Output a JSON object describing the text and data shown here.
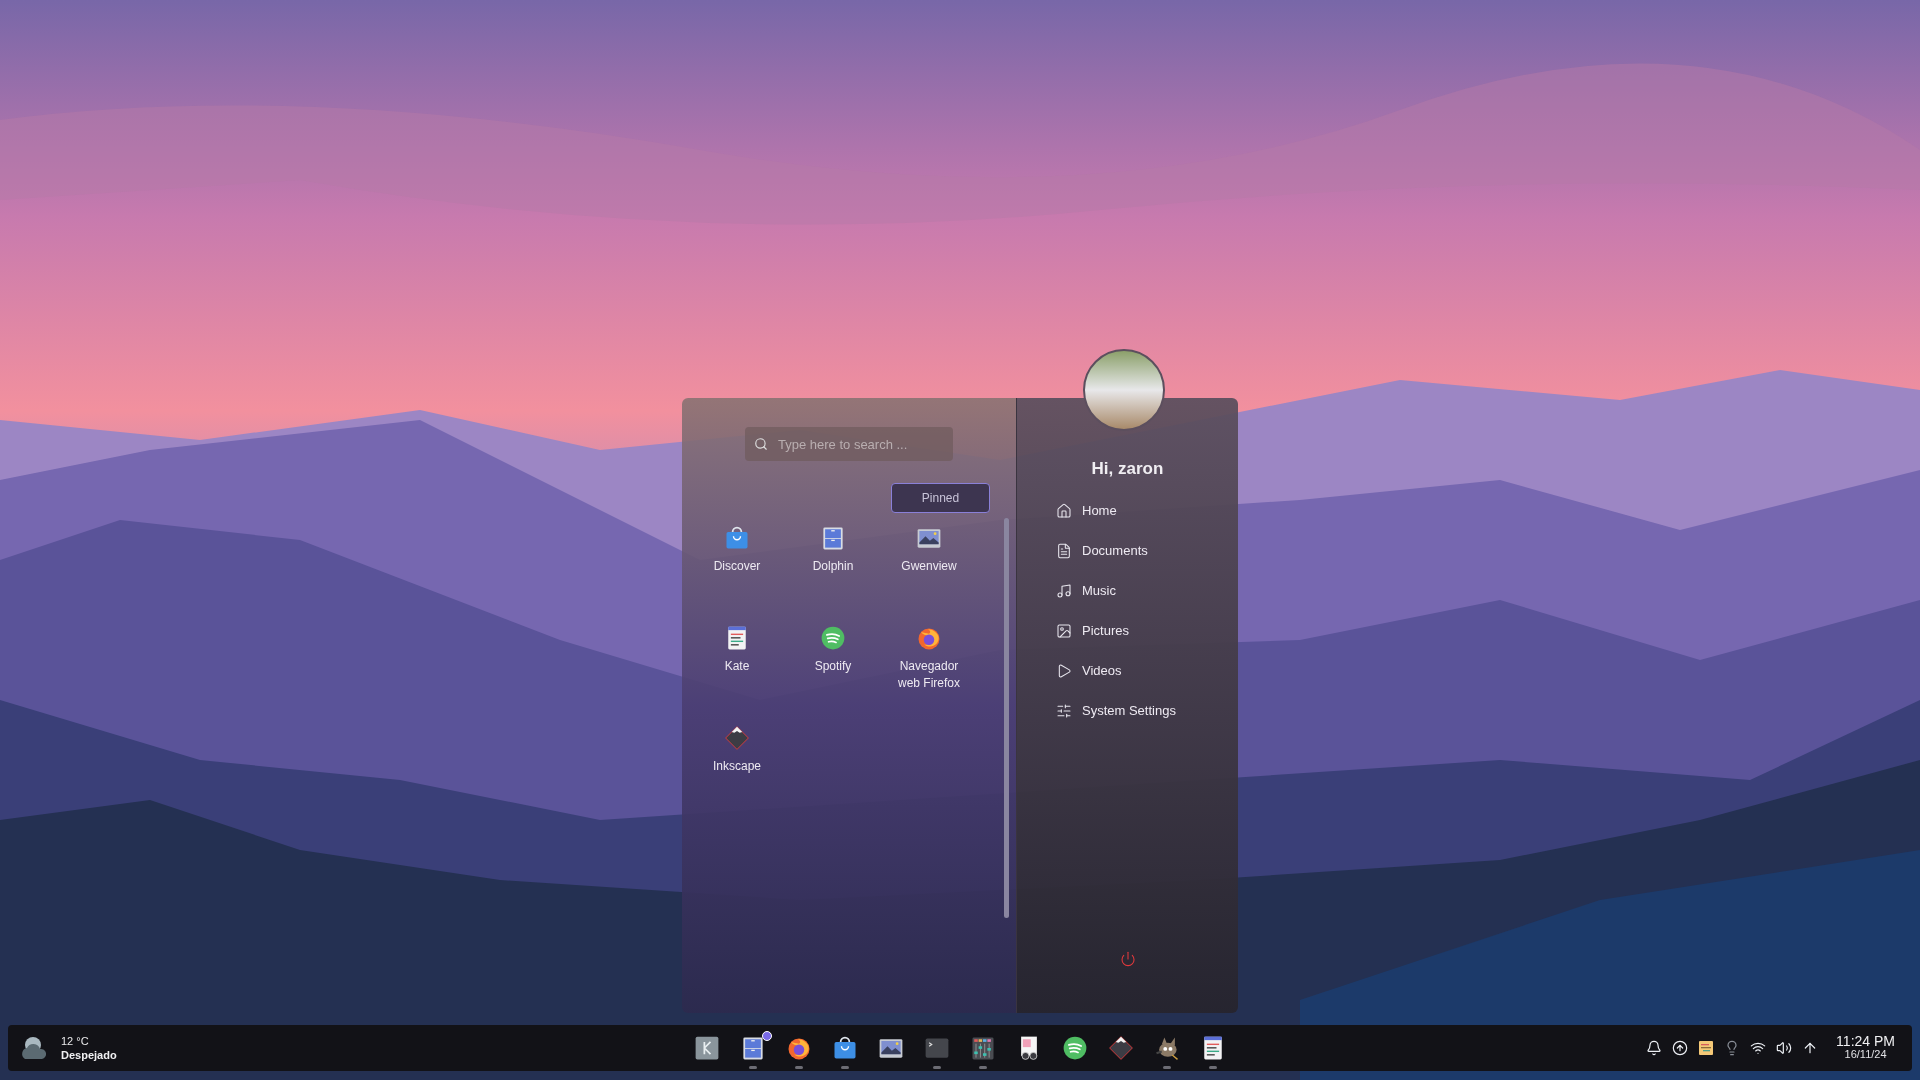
{
  "launcher": {
    "search": {
      "placeholder": "Type here to search ..."
    },
    "filter": {
      "label": "Pinned",
      "selected": true
    },
    "apps": [
      {
        "kind": "discover",
        "label": "Discover"
      },
      {
        "kind": "dolphin",
        "label": "Dolphin"
      },
      {
        "kind": "gwenview",
        "label": "Gwenview"
      },
      {
        "kind": "kate",
        "label": "Kate"
      },
      {
        "kind": "spotify",
        "label": "Spotify"
      },
      {
        "kind": "firefox",
        "label": "Navegador web Firefox"
      },
      {
        "kind": "inkscape",
        "label": "Inkscape"
      }
    ],
    "greeting": "Hi, zaron",
    "places": [
      {
        "kind": "home",
        "label": "Home"
      },
      {
        "kind": "documents",
        "label": "Documents"
      },
      {
        "kind": "music",
        "label": "Music"
      },
      {
        "kind": "pictures",
        "label": "Pictures"
      },
      {
        "kind": "videos",
        "label": "Videos"
      },
      {
        "kind": "settings",
        "label": "System Settings"
      }
    ]
  },
  "taskbar": {
    "weather": {
      "temperature": "12 °C",
      "condition": "Despejado"
    },
    "tasks": [
      {
        "kind": "launcher",
        "running": false
      },
      {
        "kind": "dolphin",
        "running": true
      },
      {
        "kind": "firefox",
        "running": true
      },
      {
        "kind": "discover",
        "running": true
      },
      {
        "kind": "gwenview",
        "running": false
      },
      {
        "kind": "terminal",
        "running": true
      },
      {
        "kind": "mixer",
        "running": true
      },
      {
        "kind": "viewer",
        "running": false
      },
      {
        "kind": "spotify",
        "running": false
      },
      {
        "kind": "inkscape",
        "running": false
      },
      {
        "kind": "gimp",
        "running": true
      },
      {
        "kind": "kate",
        "running": true
      }
    ],
    "tray": [
      {
        "kind": "notifications"
      },
      {
        "kind": "updates"
      },
      {
        "kind": "notes"
      },
      {
        "kind": "bulb"
      },
      {
        "kind": "wifi"
      },
      {
        "kind": "volume"
      },
      {
        "kind": "arrow"
      }
    ],
    "clock": {
      "time": "11:24 PM",
      "date": "16/11/24"
    }
  }
}
